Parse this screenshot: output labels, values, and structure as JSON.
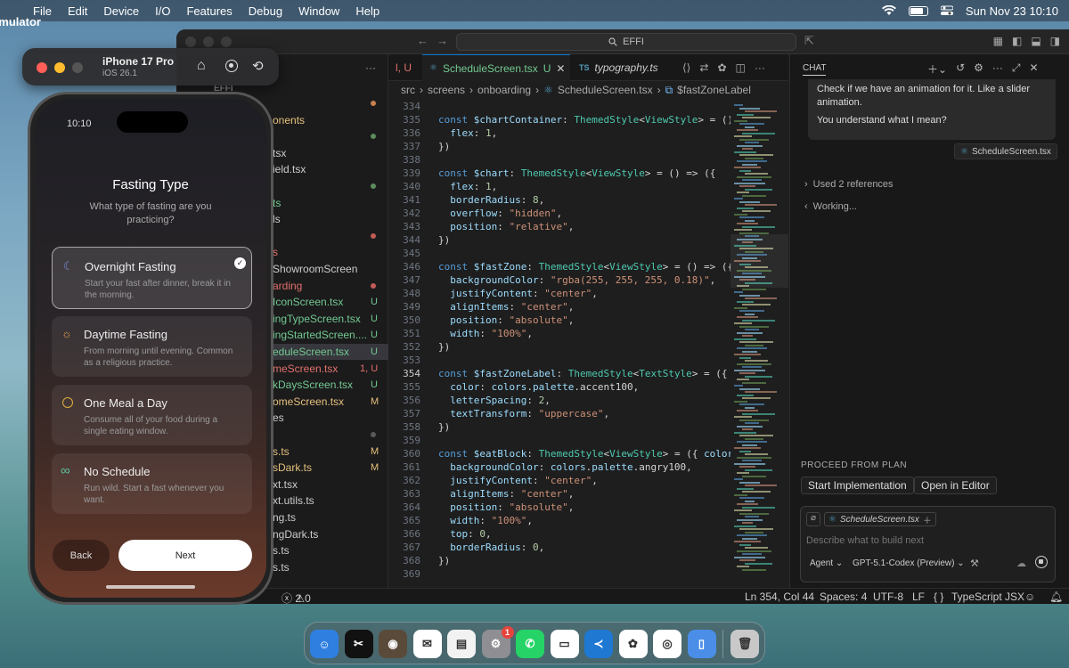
{
  "menubar": {
    "app": "Simulator",
    "items": [
      "File",
      "Edit",
      "Device",
      "I/O",
      "Features",
      "Debug",
      "Window",
      "Help"
    ],
    "datetime": "Sun Nov 23  10:10"
  },
  "simulator": {
    "device": "iPhone 17 Pro",
    "os": "iOS 26.1"
  },
  "phone": {
    "time": "10:10",
    "title": "Fasting Type",
    "subtitle": "What type of fasting are you practicing?",
    "options": [
      {
        "label": "Overnight Fasting",
        "desc": "Start your fast after dinner, break it in the morning.",
        "icon": "moon-icon",
        "selected": true
      },
      {
        "label": "Daytime Fasting",
        "desc": "From morning until evening. Common as a religious practice.",
        "icon": "sun-icon",
        "selected": false
      },
      {
        "label": "One Meal a Day",
        "desc": "Consume all of your food during a single eating window.",
        "icon": "clock-icon",
        "selected": false
      },
      {
        "label": "No Schedule",
        "desc": "Run wild. Start a fast whenever you want.",
        "icon": "infinity-icon",
        "selected": false
      }
    ],
    "back": "Back",
    "next": "Next"
  },
  "vscode": {
    "command_center": "EFFI",
    "explorer": {
      "root": "EFFI",
      "rows": [
        {
          "label": "",
          "status": "dot-orange"
        },
        {
          "label": "onents",
          "status": "",
          "color": "#e5c07b"
        },
        {
          "label": "",
          "status": "dot-green"
        },
        {
          "label": "tsx",
          "status": ""
        },
        {
          "label": "ield.tsx",
          "status": ""
        },
        {
          "label": "",
          "status": "dot-green"
        },
        {
          "label": "ts",
          "status": "",
          "color": "#73c991"
        },
        {
          "label": "ls",
          "status": ""
        },
        {
          "label": "",
          "status": "dot-red"
        },
        {
          "label": "s",
          "status": "",
          "color": "#e2706b"
        },
        {
          "label": "ShowroomScreen",
          "status": ""
        },
        {
          "label": "arding",
          "status": "dot-red",
          "color": "#e2706b"
        },
        {
          "label": "IconScreen.tsx",
          "status": "U",
          "color": "#73c991"
        },
        {
          "label": "ingTypeScreen.tsx",
          "status": "U",
          "color": "#73c991"
        },
        {
          "label": "ingStartedScreen....",
          "status": "U",
          "color": "#73c991"
        },
        {
          "label": "eduleScreen.tsx",
          "status": "U",
          "color": "#73c991",
          "active": true
        },
        {
          "label": "meScreen.tsx",
          "status": "1, U",
          "color": "#e2706b"
        },
        {
          "label": "kDaysScreen.tsx",
          "status": "U",
          "color": "#73c991"
        },
        {
          "label": "omeScreen.tsx",
          "status": "M",
          "color": "#e5c07b"
        },
        {
          "label": "es",
          "status": ""
        },
        {
          "label": "",
          "status": "dot-grey"
        },
        {
          "label": "s.ts",
          "status": "M",
          "color": "#e5c07b"
        },
        {
          "label": "sDark.ts",
          "status": "M",
          "color": "#e5c07b"
        },
        {
          "label": "xt.tsx",
          "status": ""
        },
        {
          "label": "xt.utils.ts",
          "status": ""
        },
        {
          "label": "ng.ts",
          "status": ""
        },
        {
          "label": "ngDark.ts",
          "status": ""
        },
        {
          "label": "s.ts",
          "status": ""
        },
        {
          "label": "s.ts",
          "status": ""
        }
      ]
    },
    "tabs": [
      {
        "label": "l, U",
        "lang": "",
        "active": false
      },
      {
        "label": "ScheduleScreen.tsx",
        "suffix": "U",
        "lang": "TS",
        "active": true
      },
      {
        "label": "typography.ts",
        "suffix": "",
        "lang": "TS",
        "active": false
      }
    ],
    "breadcrumbs": [
      "src",
      "screens",
      "onboarding",
      "ScheduleScreen.tsx",
      "$fastZoneLabel"
    ],
    "code": [
      {
        "n": "334",
        "t": ""
      },
      {
        "n": "335",
        "t": "const $chartContainer: ThemedStyle<ViewStyle> = () => ({"
      },
      {
        "n": "336",
        "t": "  flex: 1,"
      },
      {
        "n": "337",
        "t": "})"
      },
      {
        "n": "338",
        "t": ""
      },
      {
        "n": "339",
        "t": "const $chart: ThemedStyle<ViewStyle> = () => ({"
      },
      {
        "n": "340",
        "t": "  flex: 1,"
      },
      {
        "n": "341",
        "t": "  borderRadius: 8,"
      },
      {
        "n": "342",
        "t": "  overflow: \"hidden\","
      },
      {
        "n": "343",
        "t": "  position: \"relative\","
      },
      {
        "n": "344",
        "t": "})"
      },
      {
        "n": "345",
        "t": ""
      },
      {
        "n": "346",
        "t": "const $fastZone: ThemedStyle<ViewStyle> = () => ({"
      },
      {
        "n": "347",
        "t": "  backgroundColor: \"rgba(255, 255, 255, 0.18)\","
      },
      {
        "n": "348",
        "t": "  justifyContent: \"center\","
      },
      {
        "n": "349",
        "t": "  alignItems: \"center\","
      },
      {
        "n": "350",
        "t": "  position: \"absolute\","
      },
      {
        "n": "351",
        "t": "  width: \"100%\","
      },
      {
        "n": "352",
        "t": "})"
      },
      {
        "n": "353",
        "t": ""
      },
      {
        "n": "354",
        "t": "const $fastZoneLabel: ThemedStyle<TextStyle> = ({ colors"
      },
      {
        "n": "355",
        "t": "  color: colors.palette.accent100,"
      },
      {
        "n": "356",
        "t": "  letterSpacing: 2,"
      },
      {
        "n": "357",
        "t": "  textTransform: \"uppercase\","
      },
      {
        "n": "358",
        "t": "})"
      },
      {
        "n": "359",
        "t": ""
      },
      {
        "n": "360",
        "t": "const $eatBlock: ThemedStyle<ViewStyle> = ({ colors })"
      },
      {
        "n": "361",
        "t": "  backgroundColor: colors.palette.angry100,"
      },
      {
        "n": "362",
        "t": "  justifyContent: \"center\","
      },
      {
        "n": "363",
        "t": "  alignItems: \"center\","
      },
      {
        "n": "364",
        "t": "  position: \"absolute\","
      },
      {
        "n": "365",
        "t": "  width: \"100%\","
      },
      {
        "n": "366",
        "t": "  top: 0,"
      },
      {
        "n": "367",
        "t": "  borderRadius: 0,"
      },
      {
        "n": "368",
        "t": "})"
      },
      {
        "n": "369",
        "t": ""
      }
    ],
    "chat": {
      "title": "CHAT",
      "message_lines": [
        "Check if we have an animation for it. Like a slider animation.",
        "You understand what I mean?"
      ],
      "attachment": "ScheduleScreen.tsx",
      "references": "Used 2 references",
      "working": "Working...",
      "plan_header": "PROCEED FROM PLAN",
      "start_impl": "Start Implementation",
      "open_editor": "Open in Editor",
      "context_file": "ScheduleScreen.tsx",
      "input_placeholder": "Describe what to build next",
      "mode": "Agent",
      "model": "GPT-5.1-Codex (Preview)"
    },
    "status": {
      "problems": "2",
      "warnings": "0",
      "position": "Ln 354, Col 44",
      "spaces": "Spaces: 4",
      "encoding": "UTF-8",
      "eol": "LF",
      "lang_brace": "{ }",
      "language": "TypeScript JSX"
    }
  },
  "dock": {
    "apps": [
      {
        "icon": "finder-icon",
        "color": "#2f7fe0"
      },
      {
        "icon": "capcut-icon",
        "color": "#111111"
      },
      {
        "icon": "app-icon",
        "color": "#5a4a3a"
      },
      {
        "icon": "messenger-icon",
        "color": "#ffffff"
      },
      {
        "icon": "notes-grid-icon",
        "color": "#f2f2f2"
      },
      {
        "icon": "system-settings-icon",
        "color": "#8e8e93",
        "badge": "1"
      },
      {
        "icon": "whatsapp-icon",
        "color": "#25d366"
      },
      {
        "icon": "notes-icon",
        "color": "#ffffff"
      },
      {
        "icon": "vscode-icon",
        "color": "#1f78d1"
      },
      {
        "icon": "chatgpt-icon",
        "color": "#ffffff"
      },
      {
        "icon": "chrome-icon",
        "color": "#ffffff"
      },
      {
        "icon": "simulator-icon",
        "color": "#4a8ee8"
      },
      {
        "icon": "trash-icon",
        "color": "#c8c8c8"
      }
    ]
  }
}
